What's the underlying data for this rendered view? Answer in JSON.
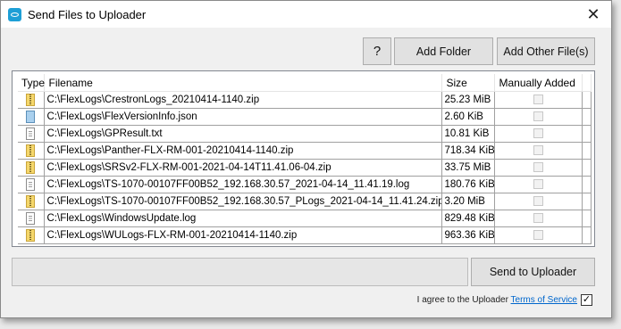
{
  "window": {
    "title": "Send Files to Uploader",
    "close_glyph": "✕"
  },
  "toolbar": {
    "help_label": "?",
    "add_folder_label": "Add Folder",
    "add_other_files_label": "Add Other File(s)"
  },
  "table": {
    "columns": [
      "Type",
      "Filename",
      "Size",
      "Manually Added"
    ],
    "rows": [
      {
        "type_icon": "zip-file-icon",
        "filename": "C:\\FlexLogs\\CrestronLogs_20210414-1140.zip",
        "size": "25.23 MiB",
        "manually_added": false
      },
      {
        "type_icon": "json-file-icon",
        "filename": "C:\\FlexLogs\\FlexVersionInfo.json",
        "size": "2.60 KiB",
        "manually_added": false
      },
      {
        "type_icon": "text-file-icon",
        "filename": "C:\\FlexLogs\\GPResult.txt",
        "size": "10.81 KiB",
        "manually_added": false
      },
      {
        "type_icon": "zip-file-icon",
        "filename": "C:\\FlexLogs\\Panther-FLX-RM-001-20210414-1140.zip",
        "size": "718.34 KiB",
        "manually_added": false
      },
      {
        "type_icon": "zip-file-icon",
        "filename": "C:\\FlexLogs\\SRSv2-FLX-RM-001-2021-04-14T11.41.06-04.zip",
        "size": "33.75 MiB",
        "manually_added": false
      },
      {
        "type_icon": "text-file-icon",
        "filename": "C:\\FlexLogs\\TS-1070-00107FF00B52_192.168.30.57_2021-04-14_11.41.19.log",
        "size": "180.76 KiB",
        "manually_added": false
      },
      {
        "type_icon": "zip-file-icon",
        "filename": "C:\\FlexLogs\\TS-1070-00107FF00B52_192.168.30.57_PLogs_2021-04-14_11.41.24.zip",
        "size": "3.20 MiB",
        "manually_added": false
      },
      {
        "type_icon": "text-file-icon",
        "filename": "C:\\FlexLogs\\WindowsUpdate.log",
        "size": "829.48 KiB",
        "manually_added": false
      },
      {
        "type_icon": "zip-file-icon",
        "filename": "C:\\FlexLogs\\WULogs-FLX-RM-001-20210414-1140.zip",
        "size": "963.36 KiB",
        "manually_added": false
      }
    ]
  },
  "footer": {
    "send_label": "Send to Uploader",
    "agree_text": "I agree to the Uploader ",
    "terms_link": "Terms of Service",
    "agree_checked": true,
    "check_glyph": "✓"
  },
  "colors": {
    "accent": "#1e9fd6",
    "link": "#0066cc"
  }
}
